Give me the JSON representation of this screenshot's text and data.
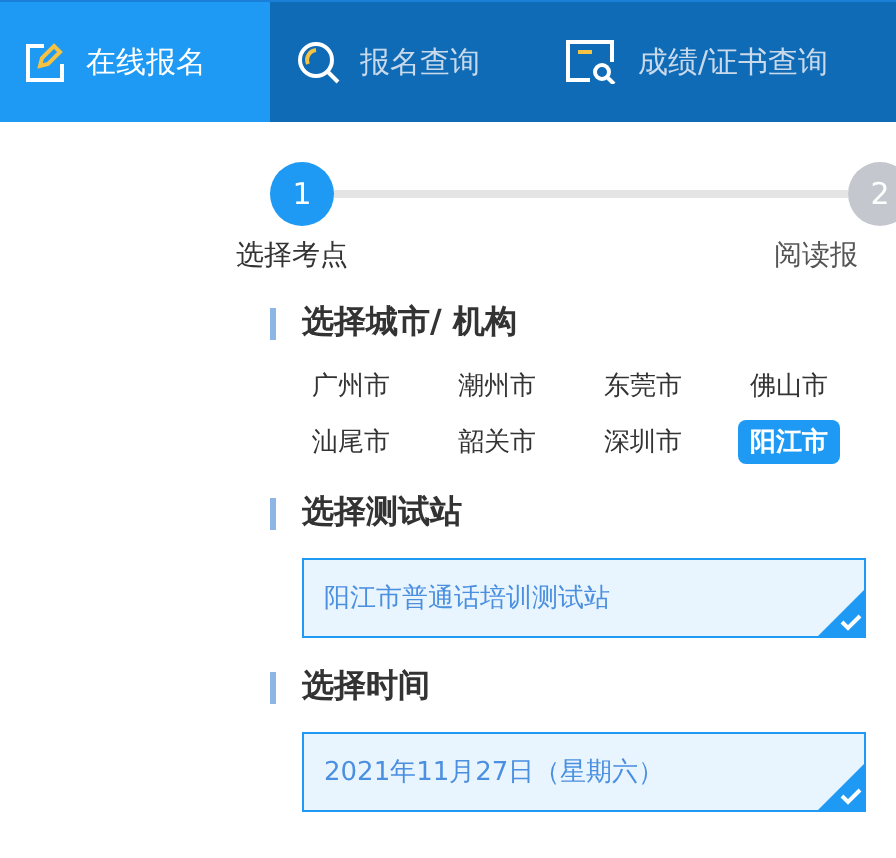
{
  "nav_tabs": [
    {
      "label": "在线报名",
      "kind": "edit",
      "selected": true
    },
    {
      "label": "报名查询",
      "kind": "search",
      "selected": false
    },
    {
      "label": "成绩/证书查询",
      "kind": "certificate",
      "selected": false
    }
  ],
  "steps": [
    {
      "number": "1",
      "label": "选择考点",
      "selected": true
    },
    {
      "number": "2",
      "label": "阅读报",
      "selected": false
    }
  ],
  "sections": [
    {
      "kind": "options",
      "title": "选择城市/ 机构",
      "options": [
        {
          "label": "广州市",
          "selected": false
        },
        {
          "label": "潮州市",
          "selected": false
        },
        {
          "label": "东莞市",
          "selected": false
        },
        {
          "label": "佛山市",
          "selected": false
        },
        {
          "label": "汕尾市",
          "selected": false
        },
        {
          "label": "韶关市",
          "selected": false
        },
        {
          "label": "深圳市",
          "selected": false
        },
        {
          "label": "阳江市",
          "selected": true
        }
      ]
    },
    {
      "kind": "cards",
      "title": "选择测试站",
      "cards": [
        {
          "label": "阳江市普通话培训测试站",
          "selected": true
        }
      ]
    },
    {
      "kind": "cards",
      "title": "选择时间",
      "cards": [
        {
          "label": "2021年11月27日（星期六）",
          "selected": true
        }
      ]
    }
  ]
}
